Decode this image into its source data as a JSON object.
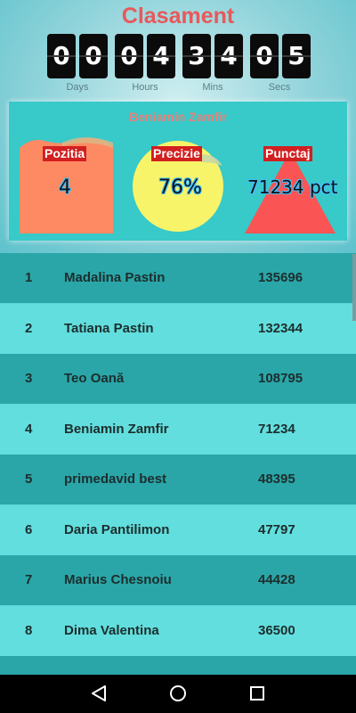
{
  "header": {
    "title": "Clasament"
  },
  "countdown": {
    "digits": [
      "0",
      "0",
      "0",
      "4",
      "3",
      "4",
      "0",
      "5"
    ],
    "labels": {
      "days": "Days",
      "hours": "Hours",
      "mins": "Mins",
      "secs": "Secs"
    }
  },
  "player_card": {
    "name": "Beniamin Zamfir",
    "position": {
      "label": "Pozitia",
      "value": "4"
    },
    "precision": {
      "label": "Precizie",
      "value": "76%"
    },
    "points": {
      "label": "Punctaj",
      "value": "71234 pct"
    }
  },
  "leaderboard": [
    {
      "rank": "1",
      "name": "Madalina Pastin",
      "score": "135696"
    },
    {
      "rank": "2",
      "name": "Tatiana Pastin",
      "score": "132344"
    },
    {
      "rank": "3",
      "name": "Teo Oană",
      "score": "108795"
    },
    {
      "rank": "4",
      "name": "Beniamin Zamfir",
      "score": "71234"
    },
    {
      "rank": "5",
      "name": "primedavid best",
      "score": "48395"
    },
    {
      "rank": "6",
      "name": "Daria Pantilimon",
      "score": "47797"
    },
    {
      "rank": "7",
      "name": "Marius Chesnoiu",
      "score": "44428"
    },
    {
      "rank": "8",
      "name": "Dima Valentina",
      "score": "36500"
    }
  ],
  "navbar": {
    "icons": [
      "back-icon",
      "home-icon",
      "recents-icon"
    ]
  },
  "colors": {
    "title": "#e8585a",
    "row_dark": "#2aa6a8",
    "row_light": "#62dede",
    "panel": "#38c9c9",
    "label_badge": "#d21f1f"
  }
}
